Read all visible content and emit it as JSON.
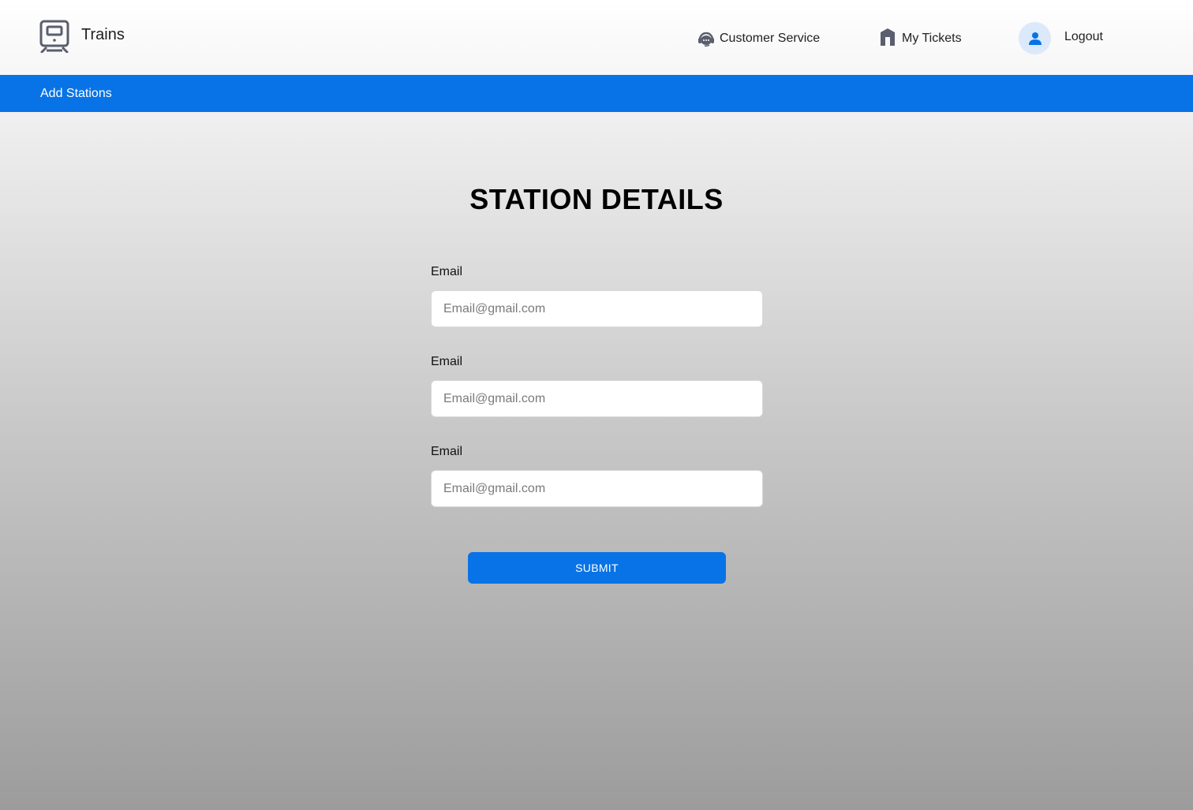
{
  "header": {
    "brand": {
      "icon": "train-icon",
      "title": "Trains"
    },
    "nav": [
      {
        "icon": "headset-icon",
        "label": "Customer Service"
      },
      {
        "icon": "ticket-icon",
        "label": "My Tickets"
      }
    ],
    "user": {
      "icon": "user-icon",
      "logout_label": "Logout"
    }
  },
  "subnav": {
    "link_label": "Add Stations"
  },
  "form": {
    "title": "STATION DETAILS",
    "fields": [
      {
        "label": "Email",
        "placeholder": "Email@gmail.com",
        "value": ""
      },
      {
        "label": "Email",
        "placeholder": "Email@gmail.com",
        "value": ""
      },
      {
        "label": "Email",
        "placeholder": "Email@gmail.com",
        "value": ""
      }
    ],
    "submit_label": "SUBMIT"
  },
  "colors": {
    "accent": "#0873e6",
    "avatar_bg": "#dbe9fb",
    "icon_gray": "#5b5e6e"
  }
}
